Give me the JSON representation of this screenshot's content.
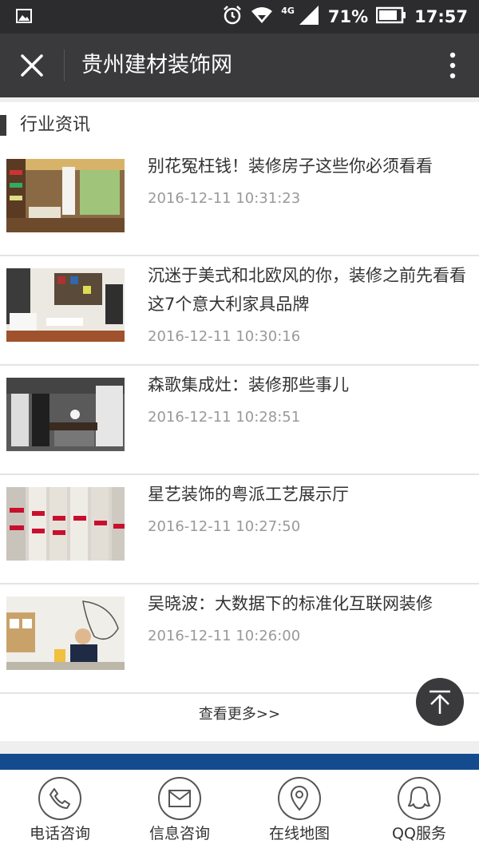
{
  "status_bar": {
    "network": "4G",
    "battery": "71%",
    "time": "17:57"
  },
  "header": {
    "title": "贵州建材装饰网"
  },
  "section": {
    "title": "行业资讯"
  },
  "news": [
    {
      "title": "别花冤枉钱！装修房子这些你必须看看",
      "time": "2016-12-11 10:31:23"
    },
    {
      "title": "沉迷于美式和北欧风的你，装修之前先看看这7个意大利家具品牌",
      "time": "2016-12-11 10:30:16"
    },
    {
      "title": "森歌集成灶：装修那些事儿",
      "time": "2016-12-11 10:28:51"
    },
    {
      "title": "星艺装饰的粤派工艺展示厅",
      "time": "2016-12-11 10:27:50"
    },
    {
      "title": "吴晓波：大数据下的标准化互联网装修",
      "time": "2016-12-11 10:26:00"
    }
  ],
  "more_link": "查看更多>>",
  "bottom_nav": [
    {
      "label": "电话咨询",
      "icon": "phone-icon"
    },
    {
      "label": "信息咨询",
      "icon": "mail-icon"
    },
    {
      "label": "在线地图",
      "icon": "map-pin-icon"
    },
    {
      "label": "QQ服务",
      "icon": "qq-icon"
    }
  ],
  "colors": {
    "status_bar": "#2c2c2e",
    "title_bar": "#3a3a3c",
    "accent_band": "#134b8e",
    "timestamp": "#999999"
  }
}
